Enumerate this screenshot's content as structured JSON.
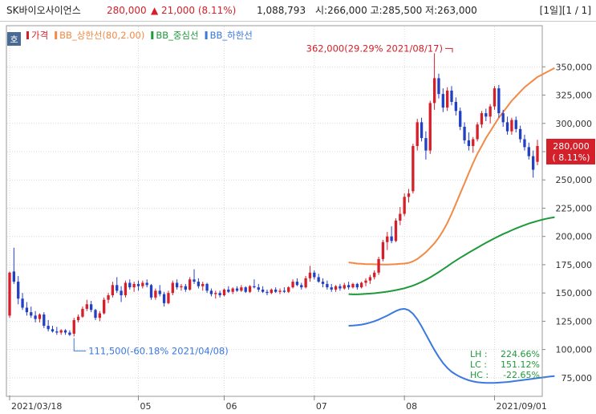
{
  "header": {
    "stock_name": "SK바이오사이언스",
    "price": "280,000",
    "change": "▲ 21,000 (8.11%)",
    "volume": "1,088,793",
    "ohl": "시:266,000 고:285,500 저:263,000",
    "pager": "[1일][1 / 1]"
  },
  "colors": {
    "up": "#d4202a",
    "down": "#2340c4",
    "upper_band": "#f28a46",
    "middle_band": "#1e9a3a",
    "lower_band": "#3b78e0",
    "grid": "#d9d9d9"
  },
  "chart_data": {
    "type": "candlestick",
    "corner_badge": "호",
    "legend": [
      {
        "label": "가격",
        "color": "#d4202a"
      },
      {
        "label": "BB_상한선(80,2.00)",
        "color": "#f28a46"
      },
      {
        "label": "BB_중심선",
        "color": "#1e9a3a"
      },
      {
        "label": "BB_하한선",
        "color": "#3b78e0"
      }
    ],
    "y_axis": {
      "min": 60000,
      "max": 385000,
      "ticks": [
        75000,
        100000,
        125000,
        150000,
        175000,
        200000,
        225000,
        250000,
        275000,
        300000,
        325000,
        350000
      ],
      "tick_labels": [
        "75,000",
        "100,000",
        "125,000",
        "150,000",
        "175,000",
        "200,000",
        "225,000",
        "250,000",
        "275,000",
        "300,000",
        "325,000",
        "350,000"
      ]
    },
    "x_axis": {
      "labels": [
        {
          "label": "2021/03/18",
          "index": 0
        },
        {
          "label": "05",
          "index": 30
        },
        {
          "label": "06",
          "index": 50
        },
        {
          "label": "07",
          "index": 71
        },
        {
          "label": "08",
          "index": 92
        },
        {
          "label": "2021/09/01",
          "index": 113
        }
      ]
    },
    "current_price": {
      "value": 280000,
      "label": "280,000",
      "change_label": "( 8.11%)"
    },
    "annotations": {
      "high": {
        "text": "362,000(29.29% 2021/08/17)",
        "index": 103,
        "value": 362000
      },
      "low": {
        "text": "111,500(-60.18% 2021/04/08)",
        "index": 15,
        "value": 111500
      }
    },
    "bb_stats": [
      {
        "label": "LH :",
        "value": "224.66%"
      },
      {
        "label": "LC :",
        "value": "151.12%"
      },
      {
        "label": "HC :",
        "value": "-22.65%"
      }
    ],
    "candles": [
      {
        "o": 130000,
        "h": 169000,
        "l": 128000,
        "c": 168000
      },
      {
        "o": 169000,
        "h": 190000,
        "l": 158000,
        "c": 160000
      },
      {
        "o": 160000,
        "h": 165000,
        "l": 140000,
        "c": 145000
      },
      {
        "o": 145000,
        "h": 150000,
        "l": 135000,
        "c": 137000
      },
      {
        "o": 137000,
        "h": 142000,
        "l": 130000,
        "c": 133000
      },
      {
        "o": 133000,
        "h": 138000,
        "l": 128000,
        "c": 130000
      },
      {
        "o": 130000,
        "h": 134000,
        "l": 124000,
        "c": 127000
      },
      {
        "o": 127000,
        "h": 132000,
        "l": 124000,
        "c": 131000
      },
      {
        "o": 131000,
        "h": 133000,
        "l": 119000,
        "c": 121000
      },
      {
        "o": 121000,
        "h": 126000,
        "l": 116000,
        "c": 118000
      },
      {
        "o": 118000,
        "h": 121000,
        "l": 115000,
        "c": 116000
      },
      {
        "o": 116000,
        "h": 120000,
        "l": 113000,
        "c": 115000
      },
      {
        "o": 115000,
        "h": 118000,
        "l": 113000,
        "c": 117000
      },
      {
        "o": 117000,
        "h": 118000,
        "l": 113000,
        "c": 115000
      },
      {
        "o": 115000,
        "h": 117000,
        "l": 112000,
        "c": 113000
      },
      {
        "o": 114000,
        "h": 128000,
        "l": 111500,
        "c": 126000
      },
      {
        "o": 126000,
        "h": 131000,
        "l": 124000,
        "c": 129000
      },
      {
        "o": 129000,
        "h": 138000,
        "l": 128000,
        "c": 136000
      },
      {
        "o": 136000,
        "h": 144000,
        "l": 134000,
        "c": 140000
      },
      {
        "o": 140000,
        "h": 143000,
        "l": 133000,
        "c": 135000
      },
      {
        "o": 135000,
        "h": 136000,
        "l": 126000,
        "c": 128000
      },
      {
        "o": 128000,
        "h": 134000,
        "l": 125000,
        "c": 132000
      },
      {
        "o": 132000,
        "h": 146000,
        "l": 131000,
        "c": 144000
      },
      {
        "o": 144000,
        "h": 150000,
        "l": 141000,
        "c": 148000
      },
      {
        "o": 148000,
        "h": 160000,
        "l": 146000,
        "c": 157000
      },
      {
        "o": 157000,
        "h": 164000,
        "l": 150000,
        "c": 152000
      },
      {
        "o": 152000,
        "h": 156000,
        "l": 142000,
        "c": 148000
      },
      {
        "o": 148000,
        "h": 161000,
        "l": 146000,
        "c": 159000
      },
      {
        "o": 159000,
        "h": 162000,
        "l": 153000,
        "c": 155000
      },
      {
        "o": 155000,
        "h": 160000,
        "l": 151000,
        "c": 158000
      },
      {
        "o": 158000,
        "h": 161000,
        "l": 152000,
        "c": 156000
      },
      {
        "o": 156000,
        "h": 161000,
        "l": 154000,
        "c": 159000
      },
      {
        "o": 159000,
        "h": 162000,
        "l": 155000,
        "c": 157000
      },
      {
        "o": 157000,
        "h": 158000,
        "l": 144000,
        "c": 146000
      },
      {
        "o": 146000,
        "h": 154000,
        "l": 144000,
        "c": 152000
      },
      {
        "o": 152000,
        "h": 157000,
        "l": 147000,
        "c": 149000
      },
      {
        "o": 149000,
        "h": 151000,
        "l": 138000,
        "c": 141000
      },
      {
        "o": 141000,
        "h": 152000,
        "l": 140000,
        "c": 150000
      },
      {
        "o": 150000,
        "h": 161000,
        "l": 148000,
        "c": 159000
      },
      {
        "o": 159000,
        "h": 162000,
        "l": 153000,
        "c": 155000
      },
      {
        "o": 155000,
        "h": 158000,
        "l": 152000,
        "c": 156000
      },
      {
        "o": 156000,
        "h": 158000,
        "l": 151000,
        "c": 153000
      },
      {
        "o": 153000,
        "h": 164000,
        "l": 152000,
        "c": 162000
      },
      {
        "o": 162000,
        "h": 171000,
        "l": 158000,
        "c": 160000
      },
      {
        "o": 160000,
        "h": 163000,
        "l": 154000,
        "c": 156000
      },
      {
        "o": 156000,
        "h": 160000,
        "l": 152000,
        "c": 158000
      },
      {
        "o": 158000,
        "h": 159000,
        "l": 150000,
        "c": 152000
      },
      {
        "o": 152000,
        "h": 154000,
        "l": 147000,
        "c": 149000
      },
      {
        "o": 149000,
        "h": 152000,
        "l": 145000,
        "c": 150000
      },
      {
        "o": 150000,
        "h": 152000,
        "l": 146000,
        "c": 148000
      },
      {
        "o": 148000,
        "h": 154000,
        "l": 147000,
        "c": 153000
      },
      {
        "o": 153000,
        "h": 156000,
        "l": 150000,
        "c": 151000
      },
      {
        "o": 151000,
        "h": 155000,
        "l": 149000,
        "c": 154000
      },
      {
        "o": 154000,
        "h": 156000,
        "l": 151000,
        "c": 152000
      },
      {
        "o": 152000,
        "h": 157000,
        "l": 151000,
        "c": 155000
      },
      {
        "o": 155000,
        "h": 156000,
        "l": 150000,
        "c": 151000
      },
      {
        "o": 151000,
        "h": 157000,
        "l": 150000,
        "c": 156000
      },
      {
        "o": 156000,
        "h": 162000,
        "l": 154000,
        "c": 155000
      },
      {
        "o": 155000,
        "h": 158000,
        "l": 151000,
        "c": 153000
      },
      {
        "o": 153000,
        "h": 156000,
        "l": 150000,
        "c": 151000
      },
      {
        "o": 151000,
        "h": 153000,
        "l": 148000,
        "c": 150000
      },
      {
        "o": 150000,
        "h": 154000,
        "l": 149000,
        "c": 153000
      },
      {
        "o": 153000,
        "h": 155000,
        "l": 150000,
        "c": 151000
      },
      {
        "o": 151000,
        "h": 154000,
        "l": 149000,
        "c": 152000
      },
      {
        "o": 152000,
        "h": 155000,
        "l": 150000,
        "c": 151000
      },
      {
        "o": 151000,
        "h": 156000,
        "l": 150000,
        "c": 155000
      },
      {
        "o": 155000,
        "h": 162000,
        "l": 154000,
        "c": 160000
      },
      {
        "o": 160000,
        "h": 163000,
        "l": 156000,
        "c": 157000
      },
      {
        "o": 157000,
        "h": 159000,
        "l": 153000,
        "c": 155000
      },
      {
        "o": 155000,
        "h": 165000,
        "l": 154000,
        "c": 163000
      },
      {
        "o": 163000,
        "h": 174000,
        "l": 160000,
        "c": 168000
      },
      {
        "o": 168000,
        "h": 170000,
        "l": 162000,
        "c": 164000
      },
      {
        "o": 164000,
        "h": 167000,
        "l": 159000,
        "c": 160000
      },
      {
        "o": 160000,
        "h": 163000,
        "l": 155000,
        "c": 158000
      },
      {
        "o": 158000,
        "h": 161000,
        "l": 153000,
        "c": 155000
      },
      {
        "o": 155000,
        "h": 158000,
        "l": 151000,
        "c": 153000
      },
      {
        "o": 153000,
        "h": 157000,
        "l": 151000,
        "c": 156000
      },
      {
        "o": 156000,
        "h": 158000,
        "l": 152000,
        "c": 154000
      },
      {
        "o": 154000,
        "h": 159000,
        "l": 153000,
        "c": 157000
      },
      {
        "o": 157000,
        "h": 160000,
        "l": 153000,
        "c": 155000
      },
      {
        "o": 155000,
        "h": 159000,
        "l": 154000,
        "c": 158000
      },
      {
        "o": 158000,
        "h": 159000,
        "l": 153000,
        "c": 155000
      },
      {
        "o": 155000,
        "h": 160000,
        "l": 154000,
        "c": 159000
      },
      {
        "o": 159000,
        "h": 163000,
        "l": 156000,
        "c": 161000
      },
      {
        "o": 161000,
        "h": 166000,
        "l": 158000,
        "c": 164000
      },
      {
        "o": 164000,
        "h": 170000,
        "l": 162000,
        "c": 168000
      },
      {
        "o": 168000,
        "h": 182000,
        "l": 166000,
        "c": 180000
      },
      {
        "o": 180000,
        "h": 197000,
        "l": 178000,
        "c": 195000
      },
      {
        "o": 195000,
        "h": 204000,
        "l": 188000,
        "c": 200000
      },
      {
        "o": 200000,
        "h": 209000,
        "l": 194000,
        "c": 196000
      },
      {
        "o": 196000,
        "h": 216000,
        "l": 195000,
        "c": 214000
      },
      {
        "o": 214000,
        "h": 226000,
        "l": 210000,
        "c": 220000
      },
      {
        "o": 220000,
        "h": 238000,
        "l": 218000,
        "c": 235000
      },
      {
        "o": 235000,
        "h": 242000,
        "l": 230000,
        "c": 238000
      },
      {
        "o": 240000,
        "h": 282000,
        "l": 238000,
        "c": 280000
      },
      {
        "o": 280000,
        "h": 304000,
        "l": 276000,
        "c": 301000
      },
      {
        "o": 301000,
        "h": 305000,
        "l": 284000,
        "c": 287000
      },
      {
        "o": 287000,
        "h": 293000,
        "l": 268000,
        "c": 276000
      },
      {
        "o": 276000,
        "h": 320000,
        "l": 273000,
        "c": 318000
      },
      {
        "o": 318000,
        "h": 362000,
        "l": 312000,
        "c": 340000
      },
      {
        "o": 340000,
        "h": 344000,
        "l": 322000,
        "c": 326000
      },
      {
        "o": 326000,
        "h": 331000,
        "l": 310000,
        "c": 314000
      },
      {
        "o": 314000,
        "h": 332000,
        "l": 311000,
        "c": 329000
      },
      {
        "o": 329000,
        "h": 333000,
        "l": 316000,
        "c": 319000
      },
      {
        "o": 319000,
        "h": 323000,
        "l": 307000,
        "c": 311000
      },
      {
        "o": 311000,
        "h": 314000,
        "l": 294000,
        "c": 297000
      },
      {
        "o": 297000,
        "h": 301000,
        "l": 282000,
        "c": 285000
      },
      {
        "o": 285000,
        "h": 292000,
        "l": 276000,
        "c": 280000
      },
      {
        "o": 280000,
        "h": 288000,
        "l": 274000,
        "c": 286000
      },
      {
        "o": 286000,
        "h": 301000,
        "l": 284000,
        "c": 299000
      },
      {
        "o": 299000,
        "h": 311000,
        "l": 296000,
        "c": 309000
      },
      {
        "o": 309000,
        "h": 313000,
        "l": 302000,
        "c": 306000
      },
      {
        "o": 306000,
        "h": 317000,
        "l": 300000,
        "c": 315000
      },
      {
        "o": 315000,
        "h": 333000,
        "l": 312000,
        "c": 331000
      },
      {
        "o": 331000,
        "h": 334000,
        "l": 305000,
        "c": 309000
      },
      {
        "o": 309000,
        "h": 312000,
        "l": 297000,
        "c": 301000
      },
      {
        "o": 301000,
        "h": 306000,
        "l": 290000,
        "c": 293000
      },
      {
        "o": 293000,
        "h": 305000,
        "l": 290000,
        "c": 303000
      },
      {
        "o": 303000,
        "h": 306000,
        "l": 292000,
        "c": 295000
      },
      {
        "o": 295000,
        "h": 298000,
        "l": 283000,
        "c": 286000
      },
      {
        "o": 286000,
        "h": 290000,
        "l": 276000,
        "c": 279000
      },
      {
        "o": 279000,
        "h": 283000,
        "l": 268000,
        "c": 271000
      },
      {
        "o": 271000,
        "h": 276000,
        "l": 252000,
        "c": 259000
      },
      {
        "o": 266000,
        "h": 285500,
        "l": 263000,
        "c": 280000
      }
    ],
    "bands": {
      "start_index": 79,
      "upper": [
        177000,
        176500,
        176000,
        175800,
        175500,
        175500,
        175400,
        175300,
        175200,
        175200,
        175300,
        175500,
        175800,
        176000,
        176600,
        178000,
        180000,
        183000,
        186000,
        190000,
        194000,
        199000,
        205000,
        212000,
        220000,
        229000,
        238000,
        247000,
        256000,
        265000,
        273000,
        280000,
        287000,
        293000,
        299000,
        305000,
        310000,
        315000,
        320000,
        324000,
        328000,
        332000,
        335000,
        338000,
        341000,
        343000,
        345000,
        347000,
        349000
      ],
      "middle": [
        149000,
        148800,
        148800,
        149000,
        149200,
        149500,
        149800,
        150200,
        150700,
        151200,
        151800,
        152500,
        153300,
        154200,
        155300,
        156600,
        158100,
        159800,
        161700,
        163800,
        166100,
        168500,
        171000,
        173600,
        176200,
        178700,
        181100,
        183400,
        185700,
        187900,
        190100,
        192300,
        194400,
        196400,
        198400,
        200300,
        202100,
        203800,
        205500,
        207100,
        208600,
        210000,
        211400,
        212600,
        213700,
        214700,
        215600,
        216400,
        217000
      ],
      "lower": [
        121000,
        121200,
        121500,
        122000,
        122800,
        123800,
        125000,
        126500,
        128200,
        130000,
        132000,
        134000,
        135500,
        136000,
        134800,
        131600,
        126800,
        120400,
        113400,
        106400,
        99600,
        93400,
        88000,
        83700,
        80300,
        77800,
        75800,
        74100,
        72800,
        71800,
        71100,
        70700,
        70500,
        70400,
        70500,
        70700,
        71000,
        71300,
        71700,
        72200,
        72700,
        73200,
        73700,
        74200,
        74700,
        75200,
        75700,
        76100,
        76500
      ]
    }
  }
}
